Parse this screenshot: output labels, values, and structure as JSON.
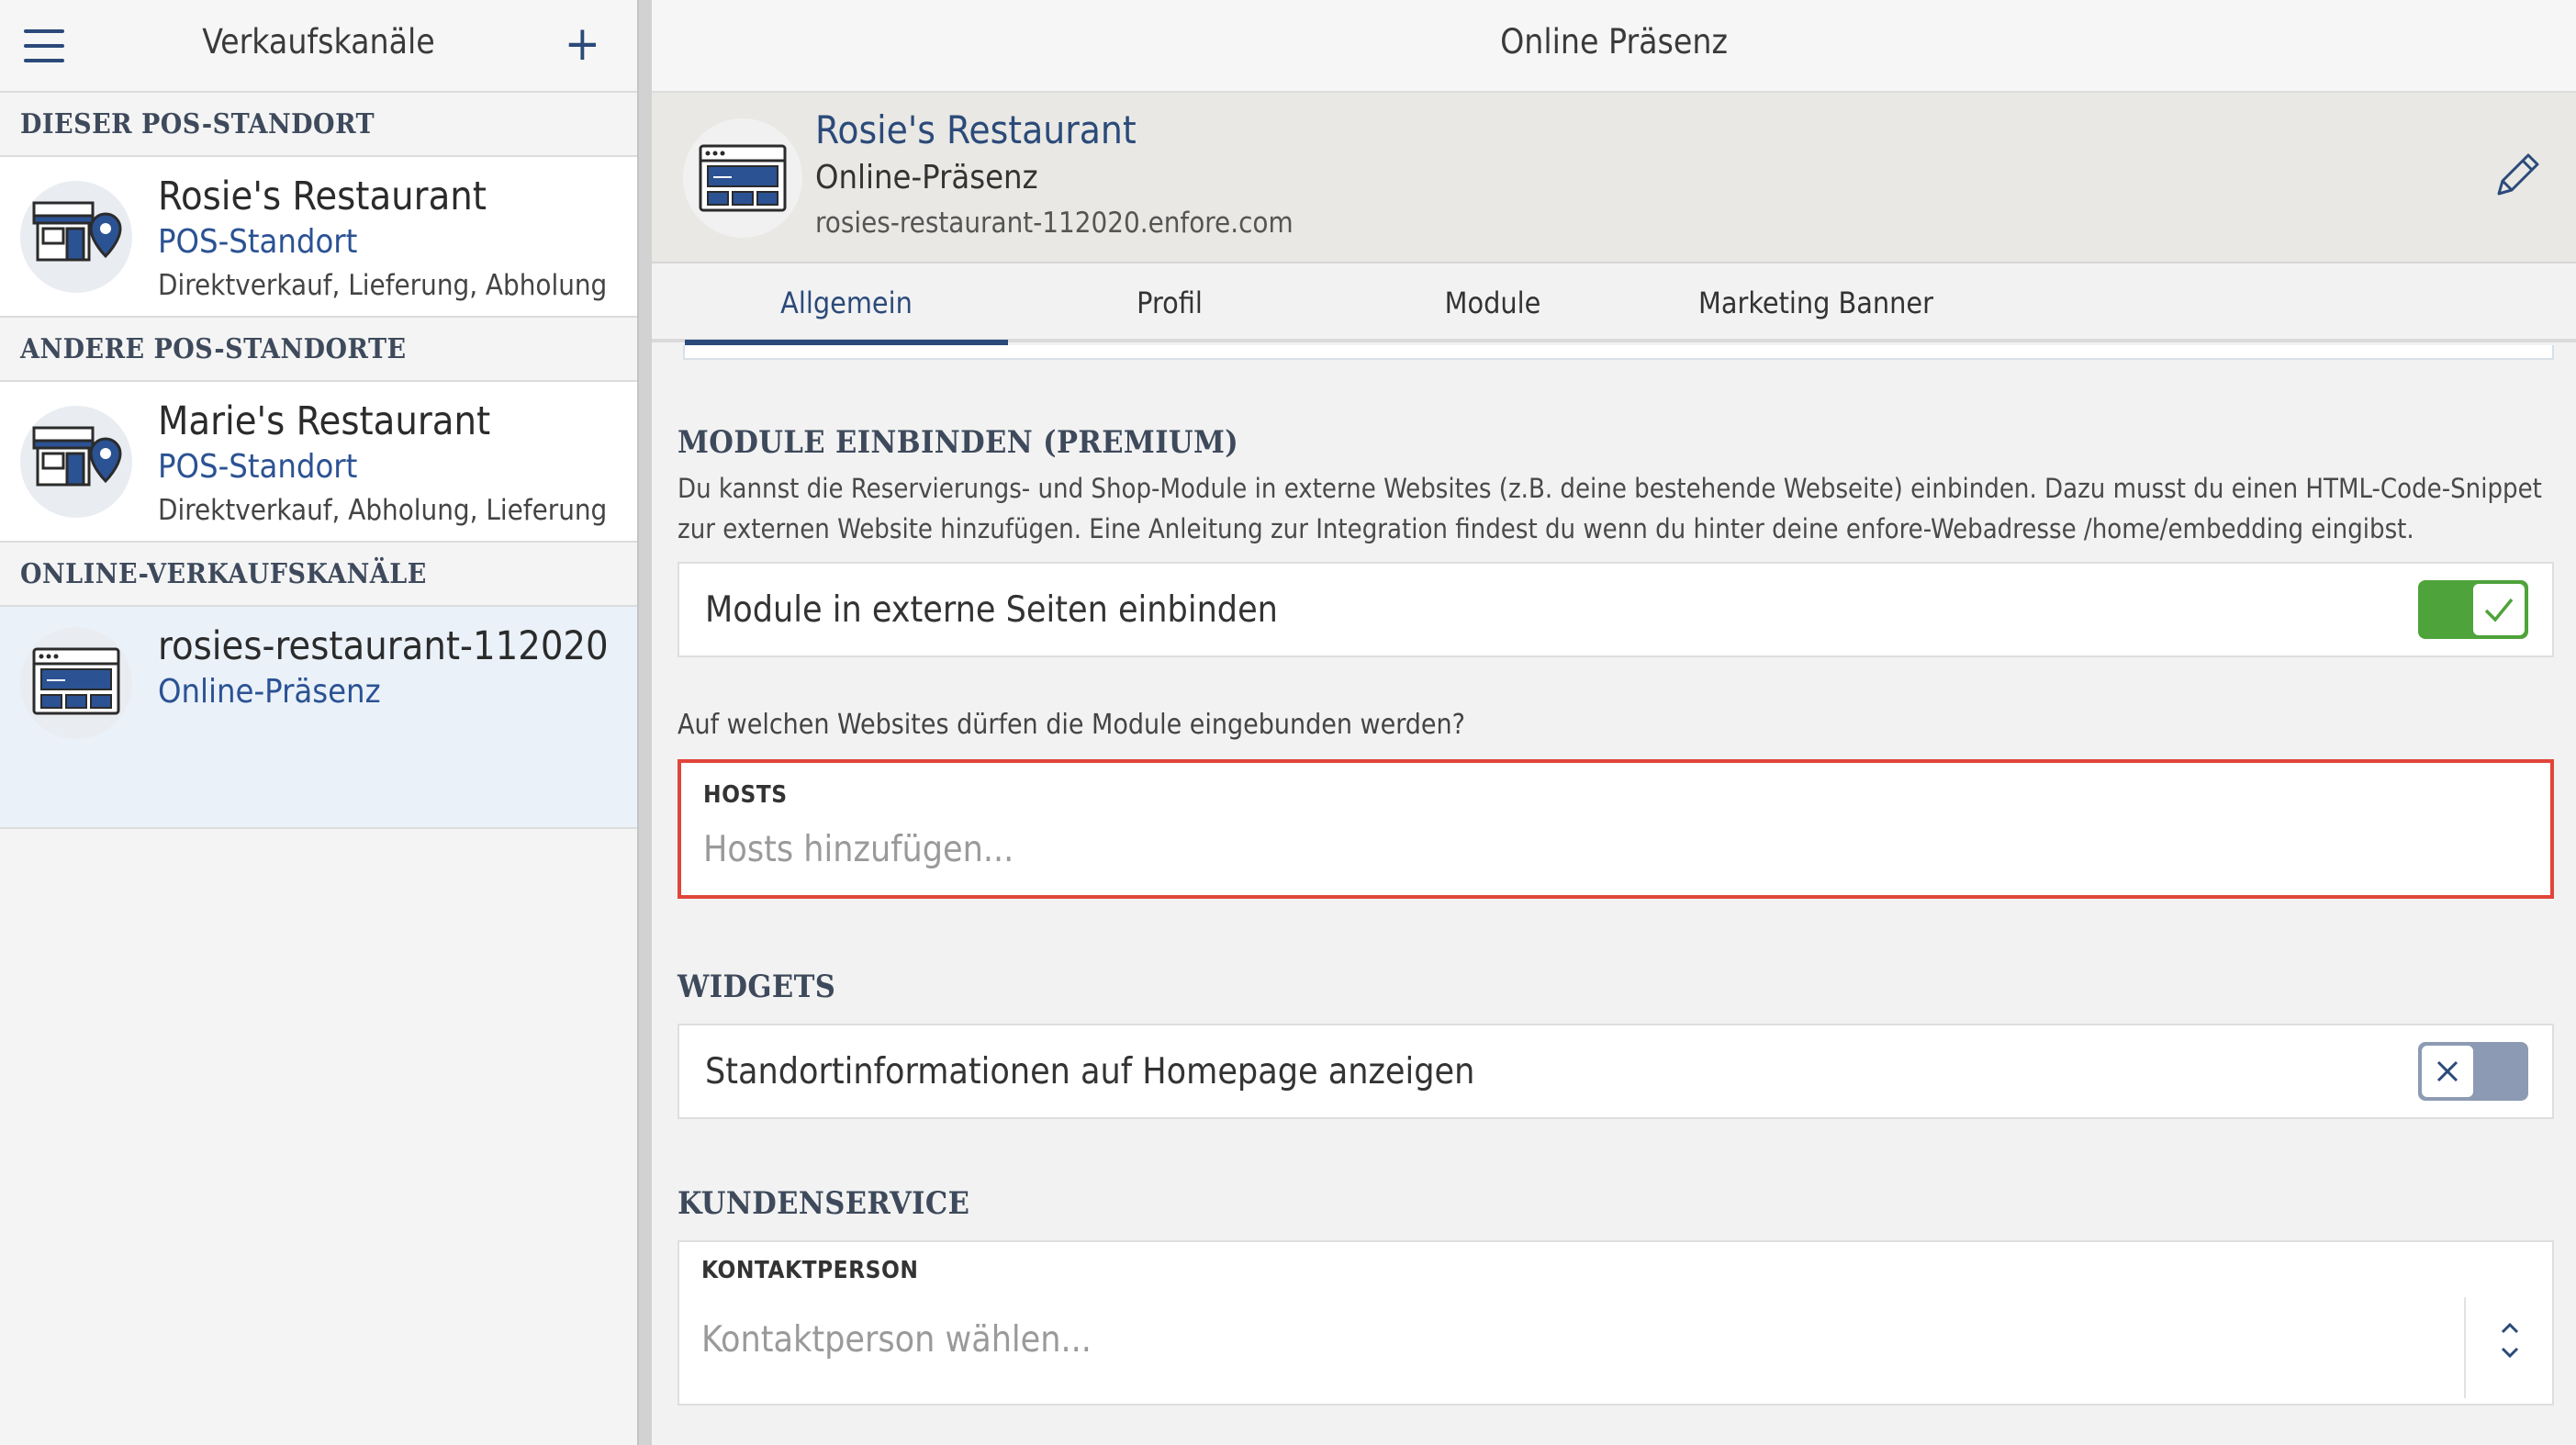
{
  "left_header": {
    "title": "Verkaufskanäle",
    "plus": "+"
  },
  "sections": {
    "this_pos": "DIESER POS-STANDORT",
    "other_pos": "ANDERE POS-STANDORTE",
    "online": "ONLINE-VERKAUFSKANÄLE"
  },
  "channels": [
    {
      "name": "Rosie's Restaurant",
      "type": "POS-Standort",
      "desc": "Direktverkauf, Lieferung, Abholung",
      "icon": "store-location-icon"
    },
    {
      "name": "Marie's Restaurant",
      "type": "POS-Standort",
      "desc": "Direktverkauf, Abholung, Lieferung",
      "icon": "store-location-icon"
    },
    {
      "name": "rosies-restaurant-112020",
      "type": "Online-Präsenz",
      "icon": "website-icon"
    }
  ],
  "right_header": {
    "title": "Online Präsenz"
  },
  "info": {
    "name": "Rosie's Restaurant",
    "type": "Online-Präsenz",
    "url": "rosies-restaurant-112020.enfore.com"
  },
  "tabs": [
    "Allgemein",
    "Profil",
    "Module",
    "Marketing Banner"
  ],
  "modules": {
    "heading": "MODULE EINBINDEN (PREMIUM)",
    "description": "Du kannst die Reservierungs- und Shop-Module in externe Websites (z.B. deine bestehende Webseite) einbinden. Dazu musst du einen HTML-Code-Snippet zur externen Website hinzufügen. Eine Anleitung zur Integration findest du wenn du hinter deine enfore-Webadresse /home/embedding eingibst.",
    "embed_label": "Module in externe Seiten einbinden",
    "embed_enabled": true,
    "question": "Auf welchen Websites dürfen die Module eingebunden werden?",
    "hosts_label": "HOSTS",
    "hosts_placeholder": "Hosts hinzufügen..."
  },
  "widgets": {
    "heading": "WIDGETS",
    "location_label": "Standortinformationen auf Homepage anzeigen",
    "location_enabled": false
  },
  "service": {
    "heading": "KUNDENSERVICE",
    "contact_label": "KONTAKTPERSON",
    "contact_placeholder": "Kontaktperson wählen..."
  },
  "colors": {
    "accent": "#2b4a7a",
    "toggle_on": "#4ea33a",
    "toggle_off": "#8c9bb3",
    "highlight_border": "#e0453a"
  }
}
